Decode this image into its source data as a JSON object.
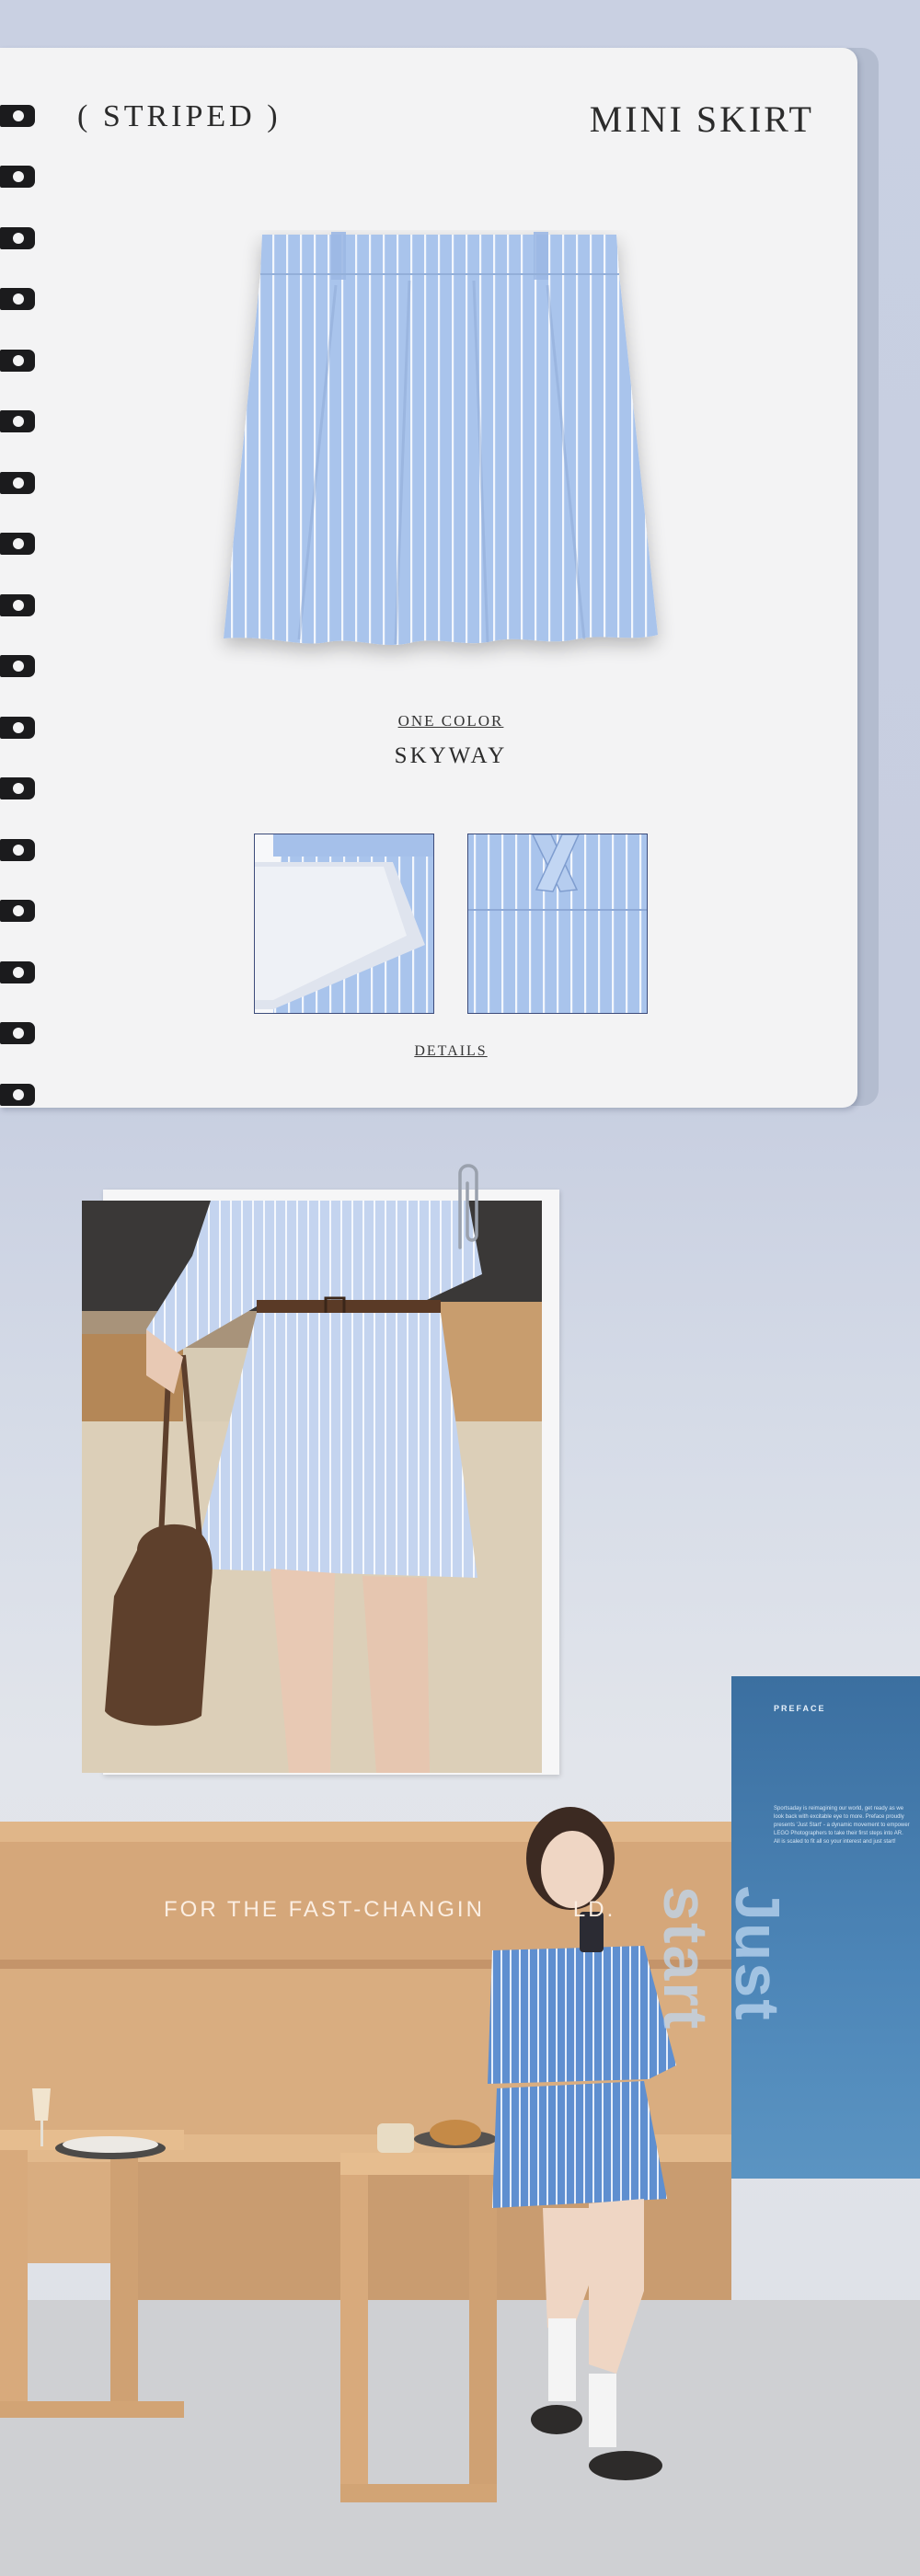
{
  "product": {
    "tag": "( STRIPED )",
    "name": "MINI SKIRT",
    "color_label": "ONE COLOR",
    "color_name": "SKYWAY",
    "details_label": "DETAILS"
  },
  "scene": {
    "wall_text": "FOR THE FAST-CHANGIN",
    "wall_text_tail": "LD.",
    "banner_title": "PREFACE",
    "banner_body": "Sportsaday is reimagining our world, get ready as we look back with excitable eye to more. Preface proudly presents 'Just Start' - a dynamic movement to empower LEGO Photographers to take their first steps into AR. All is scaled to fit all so your interest and just start!",
    "banner_big": "Just start"
  },
  "colors": {
    "skirt_base": "#a9c4ec",
    "skirt_stripe": "#f4f7fc",
    "card": "#f3f3f4",
    "background": "#c9d0e2"
  }
}
